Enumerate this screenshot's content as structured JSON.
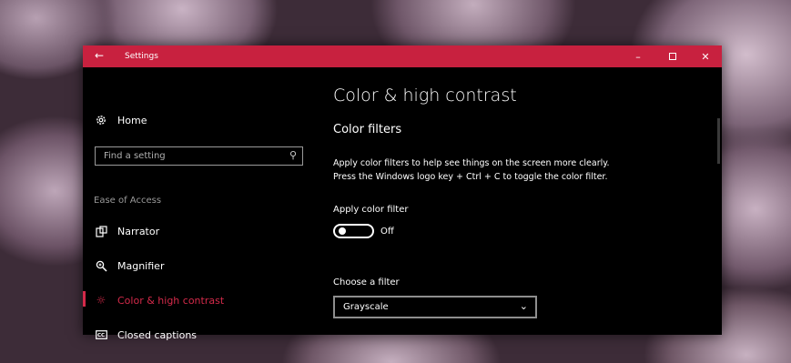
{
  "window": {
    "title": "Settings",
    "back_icon": "back-arrow-icon",
    "minimize_glyph": "–",
    "close_glyph": "✕",
    "accent": "#c8213f"
  },
  "nav": {
    "home": {
      "label": "Home",
      "icon": "gear-icon"
    },
    "search": {
      "placeholder": "Find a setting",
      "icon": "search-icon"
    },
    "section": "Ease of Access",
    "items": [
      {
        "label": "Narrator",
        "icon": "narrator-icon"
      },
      {
        "label": "Magnifier",
        "icon": "magnifier-icon"
      },
      {
        "label": "Color & high contrast",
        "icon": "brightness-icon",
        "active": true,
        "color": "#d42a4a"
      },
      {
        "label": "Closed captions",
        "icon": "closed-captions-icon"
      }
    ]
  },
  "content": {
    "title": "Color & high contrast",
    "subtitle": "Color filters",
    "description_line1": "Apply color filters to help see things on the screen more clearly.",
    "description_line2": "Press the Windows logo key + Ctrl + C to toggle the color filter.",
    "apply_label": "Apply color filter",
    "toggle_state": "Off",
    "choose_label": "Choose a filter",
    "filter_value": "Grayscale"
  }
}
